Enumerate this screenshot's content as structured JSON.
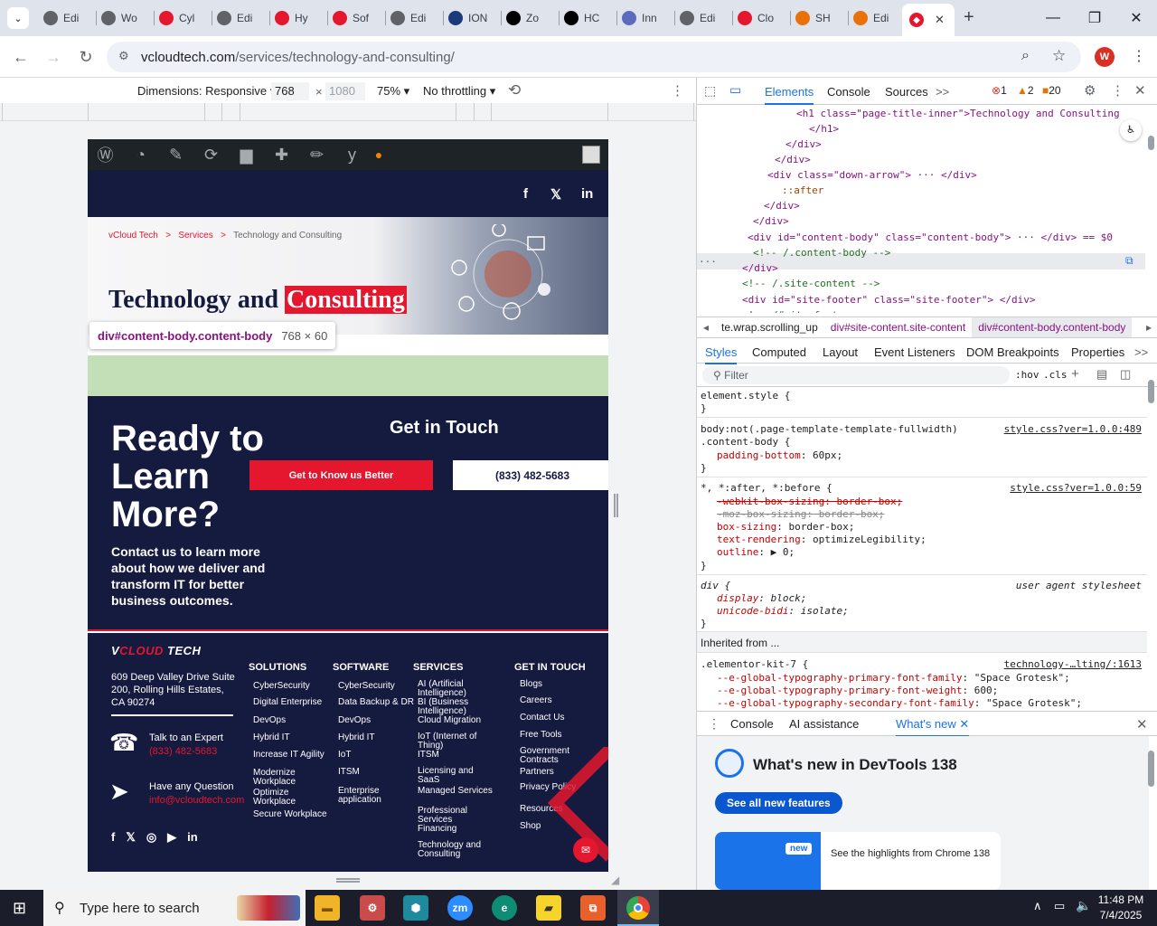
{
  "browser": {
    "tabs": [
      {
        "label": "Edi",
        "color": "#5f6368"
      },
      {
        "label": "Wo",
        "color": "#5f6368"
      },
      {
        "label": "Cyl",
        "color": "#e4172e"
      },
      {
        "label": "Edi",
        "color": "#5f6368"
      },
      {
        "label": "Hy",
        "color": "#e4172e"
      },
      {
        "label": "Sof",
        "color": "#e4172e"
      },
      {
        "label": "Edi",
        "color": "#5f6368"
      },
      {
        "label": "ION",
        "color": "#1a3a7a"
      },
      {
        "label": "Zo",
        "color": "#000000"
      },
      {
        "label": "HC",
        "color": "#000000"
      },
      {
        "label": "Inn",
        "color": "#5c6bc0"
      },
      {
        "label": "Edi",
        "color": "#5f6368"
      },
      {
        "label": "Clo",
        "color": "#e4172e"
      },
      {
        "label": "SH",
        "color": "#e8710a"
      },
      {
        "label": "Edi",
        "color": "#e8710a"
      }
    ],
    "active_tab_close": "✕",
    "new_tab": "+",
    "url_host": "vcloudtech.com",
    "url_path": "/services/technology-and-consulting/",
    "profile_initial": "W"
  },
  "device_toolbar": {
    "dimensions_label": "Dimensions: Responsive",
    "width": "768",
    "height_placeholder": "1080",
    "times": "×",
    "zoom": "75%",
    "throttle": "No throttling"
  },
  "site": {
    "breadcrumb": {
      "home": "vCloud Tech",
      "sep": ">",
      "services": "Services",
      "current": "Technology and Consulting"
    },
    "hero_title_a": "Technology and ",
    "hero_title_b": "Consulting",
    "tooltip_name": "div",
    "tooltip_class": "#content-body.content-body",
    "tooltip_dims": "768 × 60",
    "cta_heading": "Ready to Learn More?",
    "cta_sub": "Contact us to learn more about how we deliver and transform IT for better business outcomes.",
    "cta_get_in_touch": "Get in Touch",
    "cta_btn_red": "Get to Know us Better",
    "cta_btn_phone": "(833) 482-5683",
    "footer": {
      "logo_a": "V",
      "logo_b": "CLOUD",
      "logo_c": " TECH",
      "address": "609 Deep Valley Drive Suite 200, Rolling Hills Estates, CA 90274",
      "talk_label": "Talk to an Expert",
      "talk_phone": "(833) 482-5683",
      "question_label": "Have any Question",
      "question_email": "info@vcloudtech.com",
      "col_solutions": "SOLUTIONS",
      "col_software": "SOFTWARE",
      "col_services": "SERVICES",
      "col_touch": "GET IN TOUCH",
      "solutions": [
        "CyberSecurity",
        "Digital Enterprise",
        "DevOps",
        "Hybrid IT",
        "Increase IT Agility",
        "Modernize Workplace",
        "Optimize Workplace",
        "Secure Workplace"
      ],
      "software": [
        "CyberSecurity",
        "Data Backup & DR",
        "DevOps",
        "Hybrid IT",
        "IoT",
        "ITSM",
        "Enterprise application"
      ],
      "services": [
        "AI (Artificial Intelligence)",
        "BI (Business Intelligence)",
        "Cloud Migration",
        "IoT (Internet of Thing)",
        "ITSM",
        "Licensing and SaaS",
        "Managed Services",
        "Professional Services",
        "Financing",
        "Technology and Consulting"
      ],
      "touch": [
        "Blogs",
        "Careers",
        "Contact Us",
        "Free Tools",
        "Government Contracts",
        "Partners",
        "Privacy Policy",
        "Resources",
        "Shop"
      ]
    }
  },
  "devtools": {
    "tabs": [
      "Elements",
      "Console",
      "Sources",
      ">>"
    ],
    "errors": "1",
    "warnings": "2",
    "issues": "20",
    "dom_lines": [
      "<h1 class=\"page-title-inner\">Technology and Consulting",
      "</h1>",
      "</div>",
      "</div>",
      "<div class=\"down-arrow\"> ··· </div>",
      "::after",
      "</div>",
      "</div>",
      "<div id=\"content-body\" class=\"content-body\"> ··· </div> == $0",
      "<!-- /.content-body -->",
      "</div>",
      "<!-- /.site-content -->",
      "<div id=\"site-footer\" class=\"site-footer\"> </div>",
      "<!-- /#site-footer -->"
    ],
    "breadcrumbs": [
      "te.wrap.scrolling_up",
      "div#site-content.site-content",
      "div#content-body.content-body"
    ],
    "subtabs": [
      "Styles",
      "Computed",
      "Layout",
      "Event Listeners",
      "DOM Breakpoints",
      "Properties",
      ">>"
    ],
    "filter_placeholder": "Filter",
    "hov": ":hov",
    "cls": ".cls",
    "styles": {
      "element_style": "element.style {",
      "rule1_sel_a": "body:not(.page-template-template-fullwidth)",
      "rule1_sel_b": ".content-body {",
      "rule1_src": "style.css?ver=1.0.0:489",
      "rule1_prop": "padding-bottom",
      "rule1_val": "60px;",
      "rule2_sel": "*, *:after, *:before {",
      "rule2_src": "style.css?ver=1.0.0:59",
      "rule2_p1": "-webkit-box-sizing: border-box;",
      "rule2_p2": "-moz-box-sizing: border-box;",
      "rule2_p3_prop": "box-sizing",
      "rule2_p3_val": "border-box;",
      "rule2_p4_prop": "text-rendering",
      "rule2_p4_val": "optimizeLegibility;",
      "rule2_p5_prop": "outline",
      "rule2_p5_val": "▶ 0;",
      "rule3_sel": "div {",
      "rule3_src": "user agent stylesheet",
      "rule3_p1_prop": "display",
      "rule3_p1_val": "block;",
      "rule3_p2_prop": "unicode-bidi",
      "rule3_p2_val": "isolate;",
      "close_brace": "}",
      "inherited": "Inherited from ...",
      "rule4_sel": ".elementor-kit-7 {",
      "rule4_src": "technology-…lting/:1613",
      "rule4_p1_prop": "--e-global-typography-primary-font-family",
      "rule4_p1_val": "\"Space Grotesk\";",
      "rule4_p2_prop": "--e-global-typography-primary-font-weight",
      "rule4_p2_val": "600;",
      "rule4_p3_prop": "--e-global-typography-secondary-font-family",
      "rule4_p3_val": "\"Space Grotesk\";"
    },
    "drawer_tabs": [
      "Console",
      "AI assistance",
      "What's new"
    ],
    "whatsnew_title": "What's new in DevTools 138",
    "whatsnew_btn": "See all new features",
    "whatsnew_badge": "new",
    "whatsnew_card": "See the highlights from Chrome 138"
  },
  "taskbar": {
    "search_placeholder": "Type here to search",
    "time": "11:48 PM",
    "date": "7/4/2025"
  }
}
